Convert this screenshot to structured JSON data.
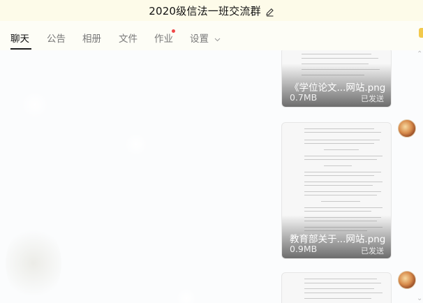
{
  "window": {
    "title": "2020级信法一班交流群"
  },
  "tabs": [
    {
      "label": "聊天",
      "active": true
    },
    {
      "label": "公告"
    },
    {
      "label": "相册"
    },
    {
      "label": "文件"
    },
    {
      "label": "作业",
      "has_dot": true
    },
    {
      "label": "设置",
      "has_dropdown": true
    }
  ],
  "messages": [
    {
      "file_name": "《学位论文...网站.png",
      "size": "0.7MB",
      "status": "已发送"
    },
    {
      "file_name": "教育部关于...网站.png",
      "size": "0.9MB",
      "status": "已发送"
    },
    {
      "file_name": "",
      "size": "",
      "status": ""
    }
  ],
  "colors": {
    "titlebar_bg": "#fdfbe9",
    "tab_active": "#111111",
    "tab_inactive": "#7a7a7a",
    "notification_dot": "#f04848"
  },
  "icons": [
    "edit-icon",
    "chevron-down-icon",
    "avatar",
    "expand-icon"
  ]
}
